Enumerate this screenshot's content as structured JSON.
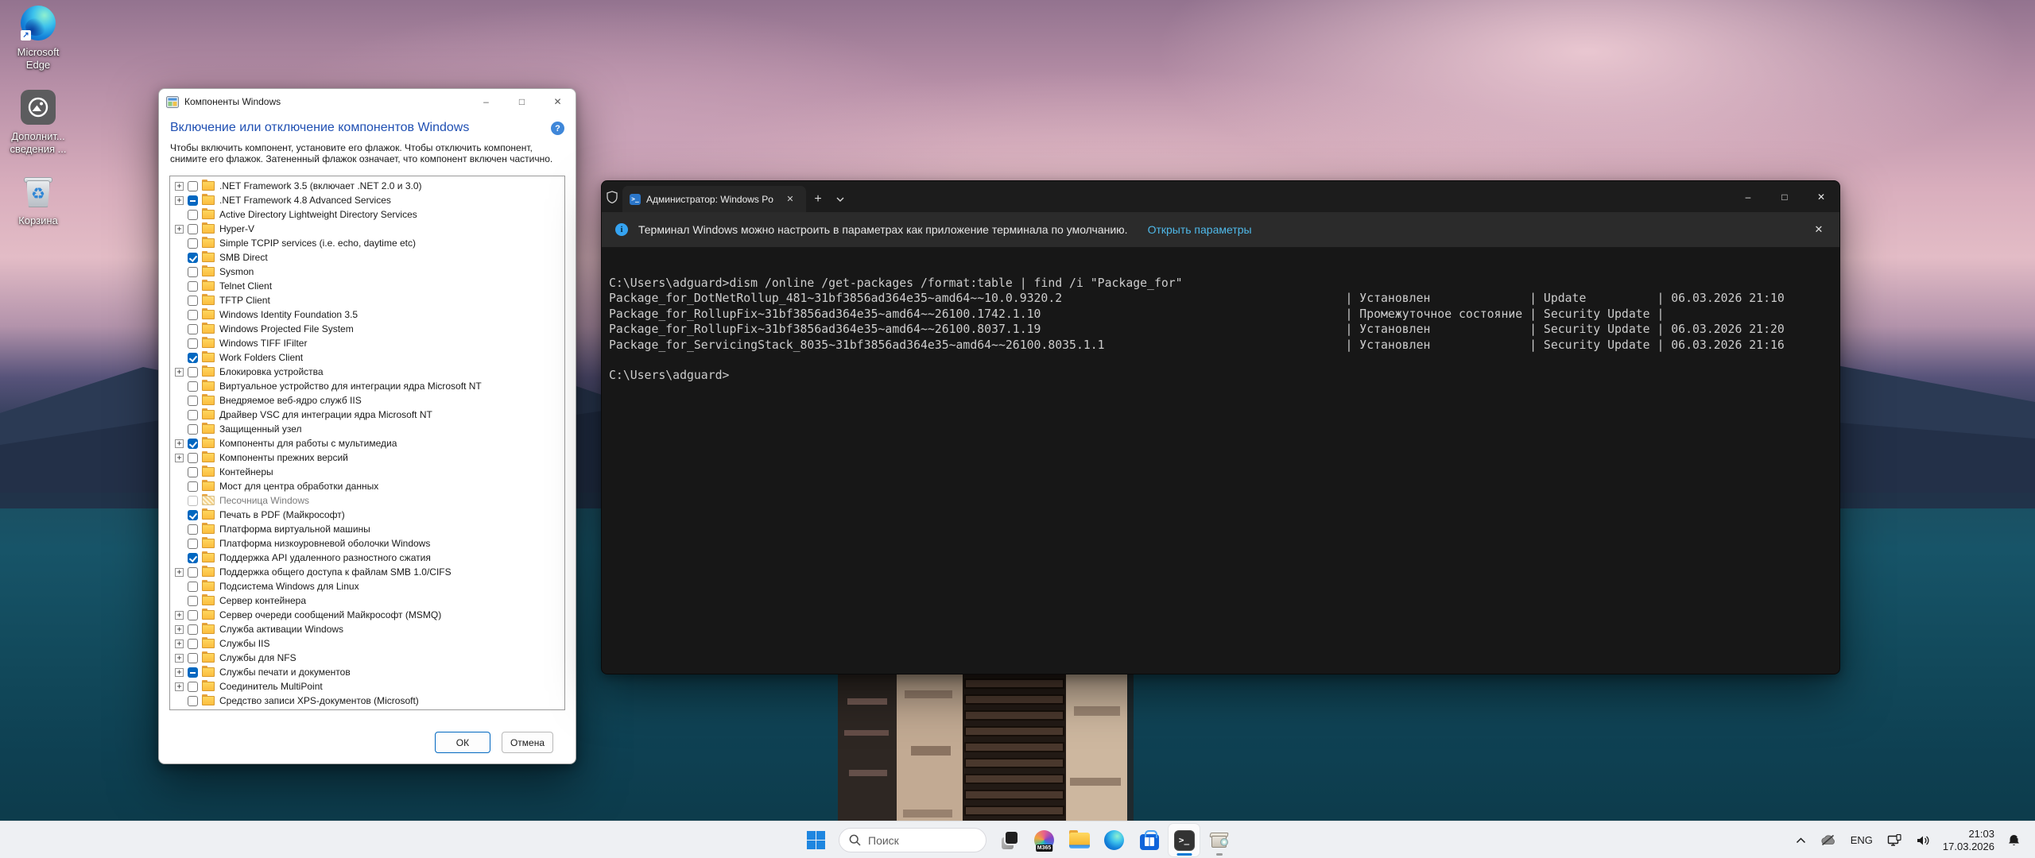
{
  "desktop": {
    "icons": [
      {
        "name": "edge-shortcut",
        "line1": "Microsoft",
        "line2": "Edge"
      },
      {
        "name": "additional-info",
        "line1": "Дополнит...",
        "line2": "сведения ..."
      },
      {
        "name": "recycle-bin",
        "line1": "Корзина",
        "line2": ""
      }
    ]
  },
  "features_dialog": {
    "window_title": "Компоненты Windows",
    "controls": {
      "minimize": "–",
      "maximize": "□",
      "close": "✕"
    },
    "help_glyph": "?",
    "heading": "Включение или отключение компонентов Windows",
    "description": "Чтобы включить компонент, установите его флажок. Чтобы отключить компонент, снимите его флажок. Затененный флажок означает, что компонент включен частично.",
    "ok_label": "ОК",
    "cancel_label": "Отмена",
    "items": [
      {
        "label": ".NET Framework 3.5 (включает .NET 2.0 и 3.0)",
        "state": "unchecked",
        "expand": true,
        "disabled": false
      },
      {
        "label": ".NET Framework 4.8 Advanced Services",
        "state": "indeterminate",
        "expand": true,
        "disabled": false
      },
      {
        "label": "Active Directory Lightweight Directory Services",
        "state": "unchecked",
        "expand": false,
        "disabled": false
      },
      {
        "label": "Hyper-V",
        "state": "unchecked",
        "expand": true,
        "disabled": false
      },
      {
        "label": "Simple TCPIP services (i.e. echo, daytime etc)",
        "state": "unchecked",
        "expand": false,
        "disabled": false
      },
      {
        "label": "SMB Direct",
        "state": "checked",
        "expand": false,
        "disabled": false
      },
      {
        "label": "Sysmon",
        "state": "unchecked",
        "expand": false,
        "disabled": false
      },
      {
        "label": "Telnet Client",
        "state": "unchecked",
        "expand": false,
        "disabled": false
      },
      {
        "label": "TFTP Client",
        "state": "unchecked",
        "expand": false,
        "disabled": false
      },
      {
        "label": "Windows Identity Foundation 3.5",
        "state": "unchecked",
        "expand": false,
        "disabled": false
      },
      {
        "label": "Windows Projected File System",
        "state": "unchecked",
        "expand": false,
        "disabled": false
      },
      {
        "label": "Windows TIFF IFilter",
        "state": "unchecked",
        "expand": false,
        "disabled": false
      },
      {
        "label": "Work Folders Client",
        "state": "checked",
        "expand": false,
        "disabled": false
      },
      {
        "label": "Блокировка устройства",
        "state": "unchecked",
        "expand": true,
        "disabled": false
      },
      {
        "label": "Виртуальное устройство для интеграции ядра Microsoft NT",
        "state": "unchecked",
        "expand": false,
        "disabled": false
      },
      {
        "label": "Внедряемое веб-ядро служб IIS",
        "state": "unchecked",
        "expand": false,
        "disabled": false
      },
      {
        "label": "Драйвер VSC для интеграции ядра Microsoft NT",
        "state": "unchecked",
        "expand": false,
        "disabled": false
      },
      {
        "label": "Защищенный узел",
        "state": "unchecked",
        "expand": false,
        "disabled": false
      },
      {
        "label": "Компоненты для работы с мультимедиа",
        "state": "checked",
        "expand": true,
        "disabled": false
      },
      {
        "label": "Компоненты прежних версий",
        "state": "unchecked",
        "expand": true,
        "disabled": false
      },
      {
        "label": "Контейнеры",
        "state": "unchecked",
        "expand": false,
        "disabled": false
      },
      {
        "label": "Мост для центра обработки данных",
        "state": "unchecked",
        "expand": false,
        "disabled": false
      },
      {
        "label": "Песочница Windows",
        "state": "unchecked",
        "expand": false,
        "disabled": true
      },
      {
        "label": "Печать в PDF (Майкрософт)",
        "state": "checked",
        "expand": false,
        "disabled": false
      },
      {
        "label": "Платформа виртуальной машины",
        "state": "unchecked",
        "expand": false,
        "disabled": false
      },
      {
        "label": "Платформа низкоуровневой оболочки Windows",
        "state": "unchecked",
        "expand": false,
        "disabled": false
      },
      {
        "label": "Поддержка API удаленного разностного сжатия",
        "state": "checked",
        "expand": false,
        "disabled": false
      },
      {
        "label": "Поддержка общего доступа к файлам SMB 1.0/CIFS",
        "state": "unchecked",
        "expand": true,
        "disabled": false
      },
      {
        "label": "Подсистема Windows для Linux",
        "state": "unchecked",
        "expand": false,
        "disabled": false
      },
      {
        "label": "Сервер контейнера",
        "state": "unchecked",
        "expand": false,
        "disabled": false
      },
      {
        "label": "Сервер очереди сообщений Майкрософт (MSMQ)",
        "state": "unchecked",
        "expand": true,
        "disabled": false
      },
      {
        "label": "Служба активации Windows",
        "state": "unchecked",
        "expand": true,
        "disabled": false
      },
      {
        "label": "Службы IIS",
        "state": "unchecked",
        "expand": true,
        "disabled": false
      },
      {
        "label": "Службы для NFS",
        "state": "unchecked",
        "expand": true,
        "disabled": false
      },
      {
        "label": "Службы печати и документов",
        "state": "indeterminate",
        "expand": true,
        "disabled": false
      },
      {
        "label": "Соединитель MultiPoint",
        "state": "unchecked",
        "expand": true,
        "disabled": false
      },
      {
        "label": "Средство записи XPS-документов (Microsoft)",
        "state": "unchecked",
        "expand": false,
        "disabled": false
      }
    ]
  },
  "terminal": {
    "tab_title": "Администратор: Windows Po",
    "tab_close": "✕",
    "new_tab": "+",
    "controls": {
      "minimize": "–",
      "maximize": "□",
      "close": "✕"
    },
    "banner_text": "Терминал Windows можно настроить в параметрах как приложение терминала по умолчанию.",
    "banner_link": "Открыть параметры",
    "banner_close": "✕",
    "info_glyph": "i",
    "prompt": "C:\\Users\\adguard>",
    "command": "dism /online /get-packages /format:table | find /i \"Package_for\"",
    "table_rows": [
      {
        "package": "Package_for_DotNetRollup_481~31bf3856ad364e35~amd64~~10.0.9320.2",
        "state": "Установлен",
        "release": "Update",
        "date": "06.03.2026 21:10"
      },
      {
        "package": "Package_for_RollupFix~31bf3856ad364e35~amd64~~26100.1742.1.10",
        "state": "Промежуточное состояние",
        "release": "Security Update",
        "date": ""
      },
      {
        "package": "Package_for_RollupFix~31bf3856ad364e35~amd64~~26100.8037.1.19",
        "state": "Установлен",
        "release": "Security Update",
        "date": "06.03.2026 21:20"
      },
      {
        "package": "Package_for_ServicingStack_8035~31bf3856ad364e35~amd64~~26100.8035.1.1",
        "state": "Установлен",
        "release": "Security Update",
        "date": "06.03.2026 21:16"
      }
    ]
  },
  "taskbar": {
    "search_placeholder": "Поиск",
    "pinned": [
      "start",
      "search",
      "task-view",
      "copilot-m365",
      "file-explorer",
      "edge",
      "store",
      "terminal",
      "windows-features"
    ],
    "active_app": "terminal",
    "tray": {
      "language": "ENG",
      "time": "21:03",
      "date": "17.03.2026",
      "icons": [
        "hidden-icons-chevron",
        "onedrive-off",
        "network",
        "volume",
        "notification-bell-dnd"
      ]
    }
  },
  "colors": {
    "accent_blue": "#0067c0",
    "dialog_heading_blue": "#2050b3",
    "terminal_bg": "#171717",
    "terminal_text": "#cccccc",
    "banner_link_blue": "#4fb8e8",
    "taskbar_bg": "#eef0f3"
  }
}
